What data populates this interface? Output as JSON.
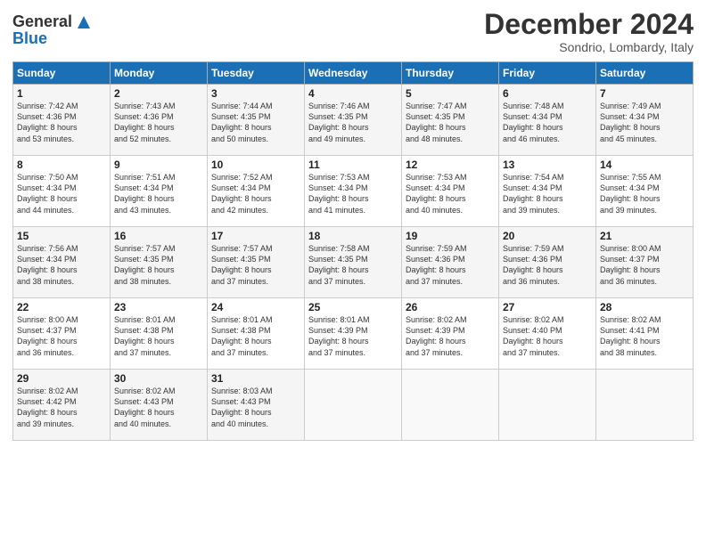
{
  "header": {
    "logo_line1": "General",
    "logo_line2": "Blue",
    "month": "December 2024",
    "location": "Sondrio, Lombardy, Italy"
  },
  "weekdays": [
    "Sunday",
    "Monday",
    "Tuesday",
    "Wednesday",
    "Thursday",
    "Friday",
    "Saturday"
  ],
  "weeks": [
    [
      {
        "day": "1",
        "sunrise": "7:42 AM",
        "sunset": "4:36 PM",
        "daylight": "8 hours and 53 minutes."
      },
      {
        "day": "2",
        "sunrise": "7:43 AM",
        "sunset": "4:36 PM",
        "daylight": "8 hours and 52 minutes."
      },
      {
        "day": "3",
        "sunrise": "7:44 AM",
        "sunset": "4:35 PM",
        "daylight": "8 hours and 50 minutes."
      },
      {
        "day": "4",
        "sunrise": "7:46 AM",
        "sunset": "4:35 PM",
        "daylight": "8 hours and 49 minutes."
      },
      {
        "day": "5",
        "sunrise": "7:47 AM",
        "sunset": "4:35 PM",
        "daylight": "8 hours and 48 minutes."
      },
      {
        "day": "6",
        "sunrise": "7:48 AM",
        "sunset": "4:34 PM",
        "daylight": "8 hours and 46 minutes."
      },
      {
        "day": "7",
        "sunrise": "7:49 AM",
        "sunset": "4:34 PM",
        "daylight": "8 hours and 45 minutes."
      }
    ],
    [
      {
        "day": "8",
        "sunrise": "7:50 AM",
        "sunset": "4:34 PM",
        "daylight": "8 hours and 44 minutes."
      },
      {
        "day": "9",
        "sunrise": "7:51 AM",
        "sunset": "4:34 PM",
        "daylight": "8 hours and 43 minutes."
      },
      {
        "day": "10",
        "sunrise": "7:52 AM",
        "sunset": "4:34 PM",
        "daylight": "8 hours and 42 minutes."
      },
      {
        "day": "11",
        "sunrise": "7:53 AM",
        "sunset": "4:34 PM",
        "daylight": "8 hours and 41 minutes."
      },
      {
        "day": "12",
        "sunrise": "7:53 AM",
        "sunset": "4:34 PM",
        "daylight": "8 hours and 40 minutes."
      },
      {
        "day": "13",
        "sunrise": "7:54 AM",
        "sunset": "4:34 PM",
        "daylight": "8 hours and 39 minutes."
      },
      {
        "day": "14",
        "sunrise": "7:55 AM",
        "sunset": "4:34 PM",
        "daylight": "8 hours and 39 minutes."
      }
    ],
    [
      {
        "day": "15",
        "sunrise": "7:56 AM",
        "sunset": "4:34 PM",
        "daylight": "8 hours and 38 minutes."
      },
      {
        "day": "16",
        "sunrise": "7:57 AM",
        "sunset": "4:35 PM",
        "daylight": "8 hours and 38 minutes."
      },
      {
        "day": "17",
        "sunrise": "7:57 AM",
        "sunset": "4:35 PM",
        "daylight": "8 hours and 37 minutes."
      },
      {
        "day": "18",
        "sunrise": "7:58 AM",
        "sunset": "4:35 PM",
        "daylight": "8 hours and 37 minutes."
      },
      {
        "day": "19",
        "sunrise": "7:59 AM",
        "sunset": "4:36 PM",
        "daylight": "8 hours and 37 minutes."
      },
      {
        "day": "20",
        "sunrise": "7:59 AM",
        "sunset": "4:36 PM",
        "daylight": "8 hours and 36 minutes."
      },
      {
        "day": "21",
        "sunrise": "8:00 AM",
        "sunset": "4:37 PM",
        "daylight": "8 hours and 36 minutes."
      }
    ],
    [
      {
        "day": "22",
        "sunrise": "8:00 AM",
        "sunset": "4:37 PM",
        "daylight": "8 hours and 36 minutes."
      },
      {
        "day": "23",
        "sunrise": "8:01 AM",
        "sunset": "4:38 PM",
        "daylight": "8 hours and 37 minutes."
      },
      {
        "day": "24",
        "sunrise": "8:01 AM",
        "sunset": "4:38 PM",
        "daylight": "8 hours and 37 minutes."
      },
      {
        "day": "25",
        "sunrise": "8:01 AM",
        "sunset": "4:39 PM",
        "daylight": "8 hours and 37 minutes."
      },
      {
        "day": "26",
        "sunrise": "8:02 AM",
        "sunset": "4:39 PM",
        "daylight": "8 hours and 37 minutes."
      },
      {
        "day": "27",
        "sunrise": "8:02 AM",
        "sunset": "4:40 PM",
        "daylight": "8 hours and 37 minutes."
      },
      {
        "day": "28",
        "sunrise": "8:02 AM",
        "sunset": "4:41 PM",
        "daylight": "8 hours and 38 minutes."
      }
    ],
    [
      {
        "day": "29",
        "sunrise": "8:02 AM",
        "sunset": "4:42 PM",
        "daylight": "8 hours and 39 minutes."
      },
      {
        "day": "30",
        "sunrise": "8:02 AM",
        "sunset": "4:43 PM",
        "daylight": "8 hours and 40 minutes."
      },
      {
        "day": "31",
        "sunrise": "8:03 AM",
        "sunset": "4:43 PM",
        "daylight": "8 hours and 40 minutes."
      },
      null,
      null,
      null,
      null
    ]
  ],
  "labels": {
    "sunrise": "Sunrise:",
    "sunset": "Sunset:",
    "daylight": "Daylight:"
  }
}
